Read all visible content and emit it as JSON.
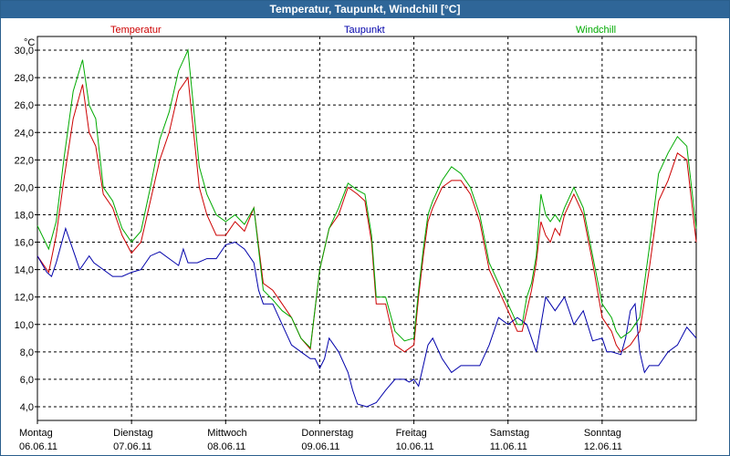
{
  "window_title": "Temperatur, Taupunkt, Windchill [°C]",
  "unit_label": "°C",
  "chart_data": {
    "type": "line",
    "title": "Temperatur, Taupunkt, Windchill [°C]",
    "ylabel": "°C",
    "ylim": [
      3,
      31
    ],
    "yticks": [
      "4,0",
      "6,0",
      "8,0",
      "10,0",
      "12,0",
      "14,0",
      "16,0",
      "18,0",
      "20,0",
      "22,0",
      "24,0",
      "26,0",
      "28,0",
      "30,0"
    ],
    "xlim": [
      0,
      7
    ],
    "grid": true,
    "x_ticks": [
      {
        "day": "Montag",
        "date": "06.06.11"
      },
      {
        "day": "Dienstag",
        "date": "07.06.11"
      },
      {
        "day": "Mittwoch",
        "date": "08.06.11"
      },
      {
        "day": "Donnerstag",
        "date": "09.06.11"
      },
      {
        "day": "Freitag",
        "date": "10.06.11"
      },
      {
        "day": "Samstag",
        "date": "11.06.11"
      },
      {
        "day": "Sonntag",
        "date": "12.06.11"
      }
    ],
    "series": [
      {
        "name": "Temperatur",
        "color": "#cc0000",
        "x": [
          0,
          0.12,
          0.2,
          0.28,
          0.38,
          0.48,
          0.55,
          0.62,
          0.7,
          0.8,
          0.9,
          1.0,
          1.1,
          1.2,
          1.3,
          1.4,
          1.5,
          1.6,
          1.72,
          1.8,
          1.9,
          2.0,
          2.1,
          2.2,
          2.3,
          2.4,
          2.5,
          2.6,
          2.7,
          2.8,
          2.9,
          3.0,
          3.1,
          3.2,
          3.3,
          3.4,
          3.48,
          3.55,
          3.6,
          3.7,
          3.8,
          3.9,
          4.0,
          4.05,
          4.1,
          4.15,
          4.2,
          4.3,
          4.4,
          4.5,
          4.6,
          4.7,
          4.8,
          4.9,
          5.0,
          5.1,
          5.15,
          5.2,
          5.25,
          5.3,
          5.35,
          5.4,
          5.45,
          5.5,
          5.55,
          5.6,
          5.7,
          5.8,
          5.9,
          6.0,
          6.05,
          6.1,
          6.15,
          6.2,
          6.3,
          6.4,
          6.5,
          6.6,
          6.7,
          6.8,
          6.9,
          7.0
        ],
        "y": [
          15.0,
          13.8,
          16.5,
          20.5,
          25.0,
          27.5,
          24.0,
          23.0,
          19.5,
          18.5,
          16.5,
          15.2,
          16.0,
          19.0,
          22.0,
          24.0,
          27.0,
          28.0,
          20.0,
          18.0,
          16.5,
          16.5,
          17.5,
          16.8,
          18.5,
          13.0,
          12.5,
          11.5,
          10.5,
          9.0,
          8.2,
          14.0,
          17.0,
          18.0,
          20.0,
          19.5,
          19.0,
          16.0,
          11.5,
          11.5,
          8.5,
          8.0,
          8.5,
          12.0,
          15.0,
          17.5,
          18.5,
          20.0,
          20.5,
          20.5,
          19.5,
          17.5,
          14.0,
          12.5,
          11.0,
          9.5,
          9.5,
          11.0,
          12.5,
          14.5,
          17.5,
          16.5,
          16.0,
          17.0,
          16.5,
          18.0,
          19.5,
          18.0,
          14.5,
          10.5,
          10.0,
          9.5,
          8.5,
          8.0,
          8.5,
          9.5,
          14.0,
          19.0,
          20.5,
          22.5,
          22.0,
          16.0
        ]
      },
      {
        "name": "Taupunkt",
        "color": "#0000aa",
        "x": [
          0,
          0.1,
          0.15,
          0.2,
          0.3,
          0.4,
          0.45,
          0.5,
          0.55,
          0.6,
          0.7,
          0.8,
          0.9,
          1.0,
          1.1,
          1.2,
          1.3,
          1.4,
          1.5,
          1.55,
          1.6,
          1.7,
          1.8,
          1.9,
          2.0,
          2.1,
          2.2,
          2.3,
          2.35,
          2.4,
          2.5,
          2.6,
          2.7,
          2.8,
          2.9,
          2.95,
          3.0,
          3.05,
          3.1,
          3.15,
          3.2,
          3.3,
          3.35,
          3.4,
          3.5,
          3.6,
          3.7,
          3.8,
          3.9,
          3.95,
          4.0,
          4.05,
          4.1,
          4.15,
          4.2,
          4.3,
          4.4,
          4.5,
          4.6,
          4.7,
          4.8,
          4.9,
          5.0,
          5.1,
          5.2,
          5.3,
          5.4,
          5.5,
          5.6,
          5.7,
          5.8,
          5.9,
          6.0,
          6.05,
          6.1,
          6.2,
          6.25,
          6.3,
          6.35,
          6.4,
          6.45,
          6.5,
          6.6,
          6.7,
          6.8,
          6.9,
          7.0
        ],
        "y": [
          15.0,
          13.8,
          13.5,
          14.5,
          17.0,
          15.0,
          14.0,
          14.5,
          15.0,
          14.5,
          14.0,
          13.5,
          13.5,
          13.8,
          14.0,
          15.0,
          15.3,
          14.8,
          14.3,
          15.5,
          14.5,
          14.5,
          14.8,
          14.8,
          15.8,
          16.0,
          15.5,
          14.5,
          12.5,
          11.5,
          11.5,
          10.0,
          8.5,
          8.0,
          7.5,
          7.5,
          6.8,
          7.5,
          9.0,
          8.5,
          8.0,
          6.5,
          5.2,
          4.2,
          4.0,
          4.3,
          5.2,
          6.0,
          6.0,
          5.8,
          6.0,
          5.5,
          7.0,
          8.5,
          9.0,
          7.5,
          6.5,
          7.0,
          7.0,
          7.0,
          8.5,
          10.5,
          10.0,
          10.5,
          10.0,
          8.0,
          12.0,
          11.0,
          12.0,
          10.0,
          11.0,
          8.8,
          9.0,
          8.0,
          8.0,
          7.8,
          9.0,
          11.0,
          11.5,
          8.0,
          6.5,
          7.0,
          7.0,
          8.0,
          8.5,
          9.8,
          9.0
        ]
      },
      {
        "name": "Windchill",
        "color": "#00aa00",
        "x": [
          0,
          0.12,
          0.2,
          0.28,
          0.38,
          0.48,
          0.55,
          0.62,
          0.7,
          0.8,
          0.9,
          1.0,
          1.1,
          1.2,
          1.3,
          1.4,
          1.5,
          1.6,
          1.72,
          1.8,
          1.9,
          2.0,
          2.1,
          2.2,
          2.3,
          2.4,
          2.5,
          2.6,
          2.7,
          2.8,
          2.9,
          3.0,
          3.1,
          3.2,
          3.3,
          3.4,
          3.48,
          3.55,
          3.6,
          3.7,
          3.8,
          3.9,
          4.0,
          4.05,
          4.1,
          4.15,
          4.2,
          4.3,
          4.4,
          4.5,
          4.6,
          4.7,
          4.8,
          4.9,
          5.0,
          5.1,
          5.15,
          5.2,
          5.25,
          5.3,
          5.35,
          5.4,
          5.45,
          5.5,
          5.55,
          5.6,
          5.7,
          5.8,
          5.9,
          6.0,
          6.05,
          6.1,
          6.15,
          6.2,
          6.3,
          6.4,
          6.5,
          6.6,
          6.7,
          6.8,
          6.9,
          7.0
        ],
        "y": [
          17.2,
          15.5,
          17.5,
          22.0,
          27.0,
          29.3,
          26.0,
          25.0,
          20.0,
          19.0,
          17.0,
          16.0,
          16.8,
          20.0,
          23.5,
          25.5,
          28.5,
          30.0,
          21.5,
          19.5,
          18.0,
          17.5,
          18.0,
          17.3,
          18.5,
          12.5,
          11.8,
          11.0,
          10.5,
          9.0,
          8.3,
          14.0,
          17.0,
          18.5,
          20.3,
          19.8,
          19.5,
          16.5,
          12.0,
          12.0,
          9.5,
          8.8,
          9.0,
          12.5,
          15.5,
          18.0,
          19.0,
          20.5,
          21.5,
          21.0,
          20.0,
          18.0,
          14.5,
          13.0,
          11.5,
          10.0,
          10.0,
          12.0,
          13.0,
          15.0,
          19.5,
          18.0,
          17.5,
          18.0,
          17.5,
          18.5,
          20.0,
          18.5,
          15.0,
          11.5,
          11.0,
          10.5,
          9.5,
          9.0,
          9.5,
          10.5,
          15.5,
          21.0,
          22.5,
          23.7,
          23.0,
          17.0
        ]
      }
    ]
  }
}
